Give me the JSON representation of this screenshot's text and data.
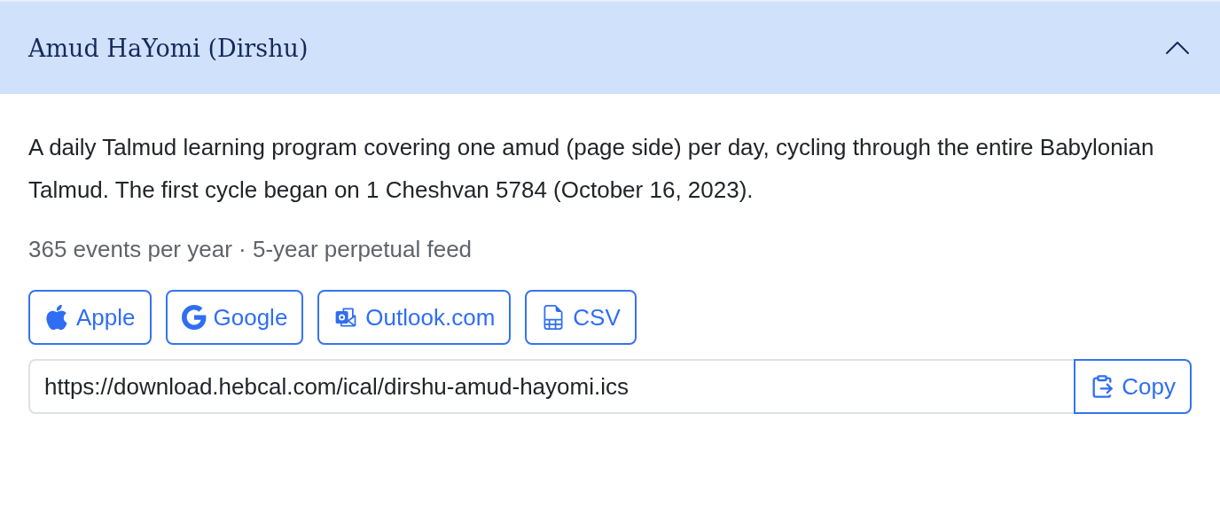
{
  "accordion": {
    "title": "Amud HaYomi (Dirshu)",
    "expanded": true,
    "description": "A daily Talmud learning program covering one amud (page side) per day, cycling through the entire Babylonian Talmud. The first cycle began on 1 Cheshvan 5784 (October 16, 2023).",
    "meta": "365 events per year · 5-year perpetual feed",
    "buttons": [
      {
        "kind": "apple",
        "label": "Apple"
      },
      {
        "kind": "google",
        "label": "Google"
      },
      {
        "kind": "outlook",
        "label": "Outlook.com"
      },
      {
        "kind": "csv",
        "label": "CSV"
      }
    ],
    "feed_url": {
      "value": "https://download.hebcal.com/ical/dirshu-amud-hayomi.ics"
    },
    "copy_button": {
      "label": "Copy"
    }
  }
}
